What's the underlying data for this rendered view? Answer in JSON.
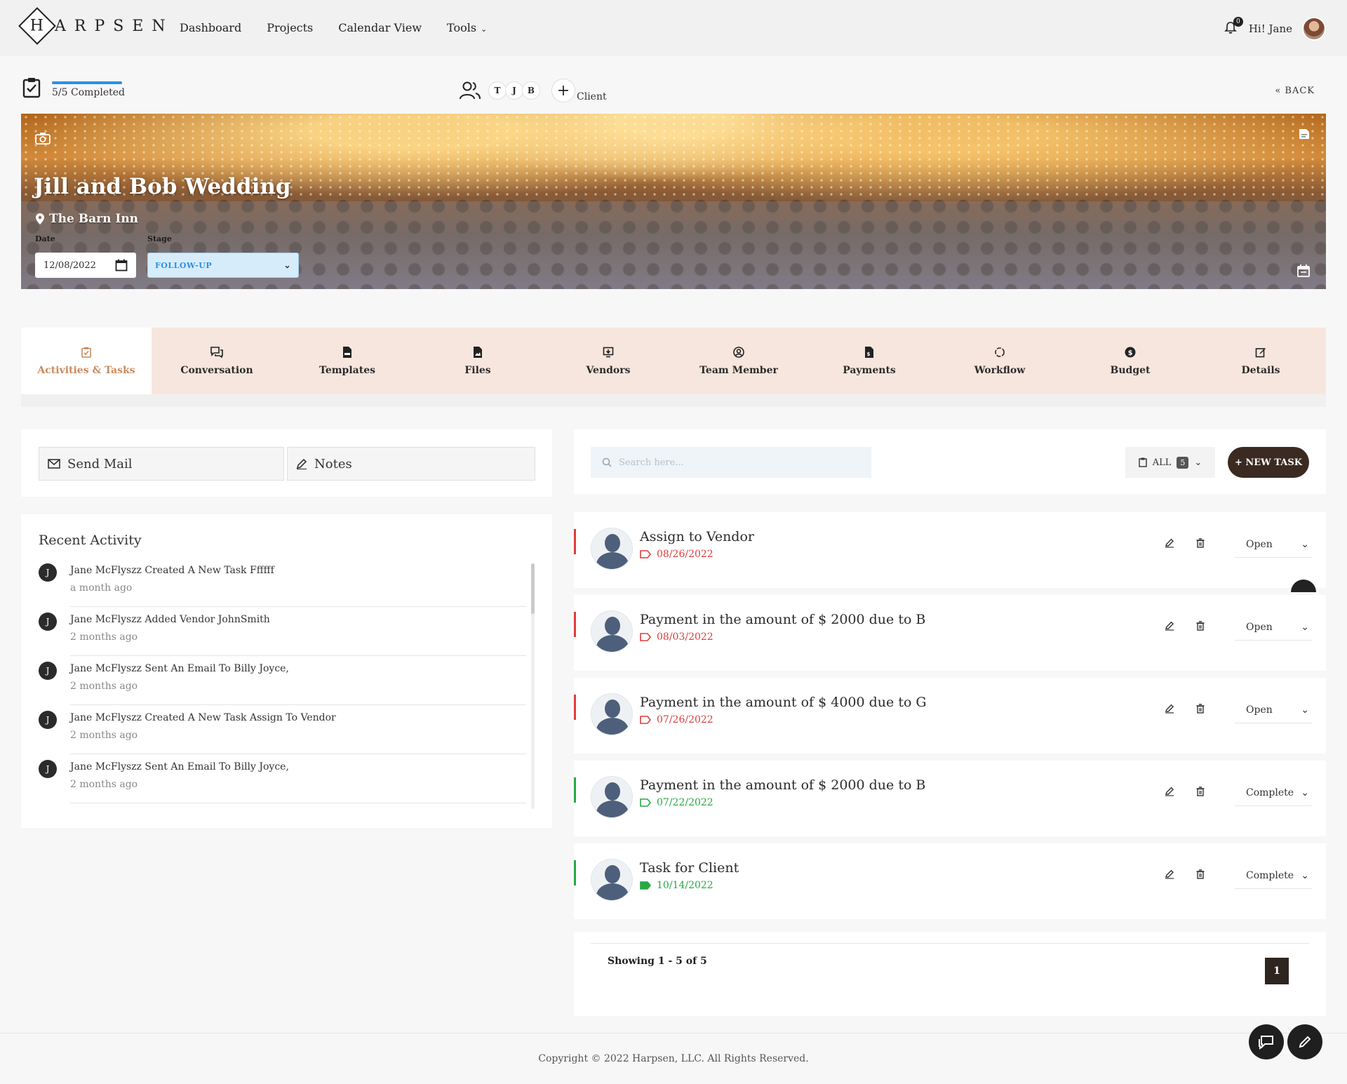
{
  "header": {
    "logo_letter": "H",
    "logo_text": "ARPSEN",
    "nav": [
      {
        "label": "Dashboard"
      },
      {
        "label": "Projects"
      },
      {
        "label": "Calendar View"
      },
      {
        "label": "Tools"
      }
    ],
    "notification_count": "0",
    "greeting": "Hi! Jane"
  },
  "status": {
    "progress_text": "5/5 Completed",
    "progress_fraction": 1.0,
    "team_initials": [
      "T",
      "J",
      "B"
    ],
    "add_client_label": "Client",
    "back_label": "« BACK"
  },
  "event": {
    "title": "Jill and Bob Wedding",
    "location": "The Barn Inn",
    "date_label": "Date",
    "date_value": "12/08/2022",
    "stage_label": "Stage",
    "stage_value": "FOLLOW-UP"
  },
  "tabs": [
    {
      "label": "Activities & Tasks",
      "icon": "clipboard-check-icon",
      "active": true
    },
    {
      "label": "Conversation",
      "icon": "chat-icon"
    },
    {
      "label": "Templates",
      "icon": "document-icon"
    },
    {
      "label": "Files",
      "icon": "image-file-icon"
    },
    {
      "label": "Vendors",
      "icon": "vendor-icon"
    },
    {
      "label": "Team Member",
      "icon": "user-circle-icon"
    },
    {
      "label": "Payments",
      "icon": "invoice-icon"
    },
    {
      "label": "Workflow",
      "icon": "workflow-icon"
    },
    {
      "label": "Budget",
      "icon": "dollar-icon"
    },
    {
      "label": "Details",
      "icon": "edit-icon"
    }
  ],
  "actions": {
    "send_mail": "Send Mail",
    "notes": "Notes"
  },
  "recent_activity": {
    "title": "Recent Activity",
    "items": [
      {
        "initial": "J",
        "text": "Jane McFlyszz Created A New Task Ffffff",
        "time": "a month ago"
      },
      {
        "initial": "J",
        "text": "Jane McFlyszz Added Vendor JohnSmith",
        "time": "2 months ago"
      },
      {
        "initial": "J",
        "text": "Jane McFlyszz Sent An Email To Billy Joyce,",
        "time": "2 months ago"
      },
      {
        "initial": "J",
        "text": "Jane McFlyszz Created A New Task Assign To Vendor",
        "time": "2 months ago"
      },
      {
        "initial": "J",
        "text": "Jane McFlyszz Sent An Email To Billy Joyce,",
        "time": "2 months ago"
      }
    ]
  },
  "tasks_toolbar": {
    "search_placeholder": "Search here...",
    "filter_label": "ALL",
    "filter_count": "5",
    "new_task_label": "+ NEW TASK"
  },
  "tasks": [
    {
      "title": "Assign to Vendor",
      "date": "08/26/2022",
      "status": "Open",
      "color": "#e03c3c"
    },
    {
      "title": "Payment in the amount of $ 2000 due to B",
      "date": "08/03/2022",
      "status": "Open",
      "color": "#e03c3c"
    },
    {
      "title": "Payment in the amount of $ 4000 due to G",
      "date": "07/26/2022",
      "status": "Open",
      "color": "#e03c3c"
    },
    {
      "title": "Payment in the amount of $ 2000 due to B",
      "date": "07/22/2022",
      "status": "Complete",
      "color": "#27a844"
    },
    {
      "title": "Task for Client",
      "date": "10/14/2022",
      "status": "Complete",
      "color": "#27a844"
    }
  ],
  "pagination": {
    "showing_text": "Showing 1 - 5 of 5",
    "current_page": "1"
  },
  "footer": {
    "copyright": "Copyright © 2022 Harpsen, LLC. All Rights Reserved."
  },
  "colors": {
    "accent_brown": "#3b2a21",
    "tab_background": "#f7e6dd",
    "active_tab_text": "#c98a5d",
    "overdue_red": "#e03c3c",
    "complete_green": "#27a844",
    "progress_blue": "#2b8fe8"
  }
}
